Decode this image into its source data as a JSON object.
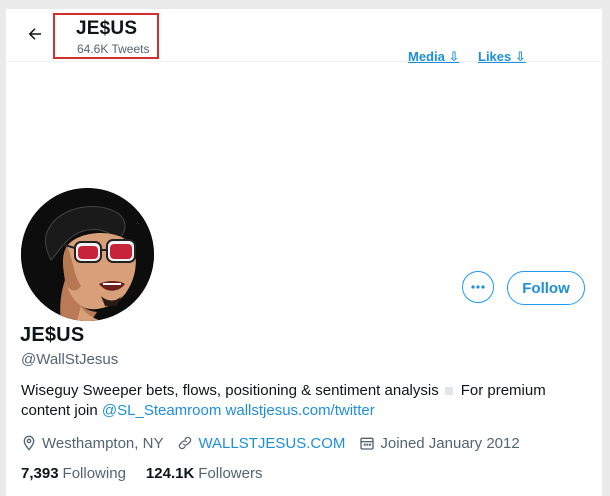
{
  "header": {
    "display_name": "JE$US",
    "tweet_count": "64.6K Tweets",
    "media_link": "Media ⇩",
    "likes_link": "Likes ⇩"
  },
  "profile": {
    "display_name": "JE$US",
    "handle": "@WallStJesus",
    "avatar_icon": "profile-avatar-illustration",
    "follow_label": "Follow",
    "more_icon": "more-dots-icon",
    "bio_text": "Wiseguy Sweeper bets, flows, positioning & sentiment analysis",
    "bio_text_2": "For premium content join",
    "bio_mention": "@SL_Steamroom",
    "bio_link": "wallstjesus.com/twitter",
    "location": "Westhampton, NY",
    "website": "WALLSTJESUS.COM",
    "joined": "Joined January 2012",
    "following_count": "7,393",
    "following_label": "Following",
    "followers_count": "124.1K",
    "followers_label": "Followers"
  },
  "colors": {
    "accent": "#1d9bf0",
    "highlight_box": "#d32f2f",
    "secondary_text": "#536471"
  }
}
